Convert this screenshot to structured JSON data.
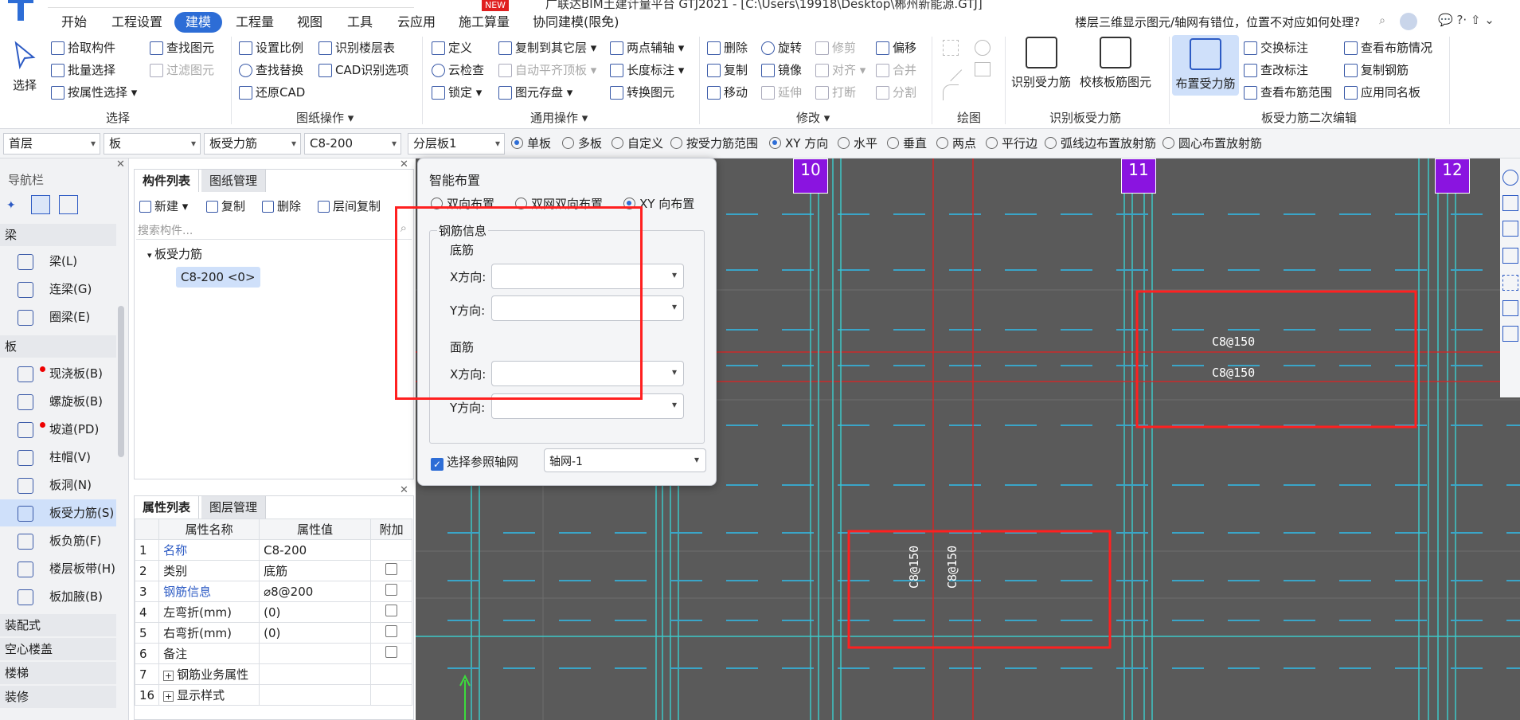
{
  "title": {
    "text": "广联达BIM土建计量平台 GTJ2021 - [C:\\Users\\19918\\Desktop\\郴州新能源.GTJ]",
    "new_badge": "NEW",
    "help_search": "楼层三维显示图元/轴网有错位，位置不对应如何处理?"
  },
  "menu": [
    "开始",
    "工程设置",
    "建模",
    "工程量",
    "视图",
    "工具",
    "云应用",
    "施工算量",
    "协同建模(限免)"
  ],
  "ribbon": {
    "select_btn": "选择",
    "select": [
      "拾取构件",
      "批量选择",
      "按属性选择",
      "查找图元",
      "过滤图元"
    ],
    "select_group": "选择",
    "drawing": [
      "设置比例",
      "识别楼层表",
      "查找替换",
      "CAD识别选项",
      "还原CAD"
    ],
    "drawing_group": "图纸操作",
    "common": [
      "定义",
      "复制到其它层",
      "两点辅轴",
      "云检查",
      "自动平齐顶板",
      "长度标注",
      "锁定",
      "图元存盘",
      "转换图元"
    ],
    "common_group": "通用操作",
    "modify": [
      "删除",
      "旋转",
      "修剪",
      "偏移",
      "复制",
      "镜像",
      "对齐",
      "合并",
      "移动",
      "延伸",
      "打断",
      "分割"
    ],
    "modify_group": "修改",
    "draw_group": "绘图",
    "recog": [
      "识别受力筋",
      "校核板筋图元"
    ],
    "recog_group": "识别板受力筋",
    "place_btn": "布置受力筋",
    "edit": [
      "交换标注",
      "查看布筋情况",
      "查改标注",
      "复制钢筋",
      "查看布筋范围",
      "应用同名板"
    ],
    "edit_group": "板受力筋二次编辑"
  },
  "optbar": {
    "floor": "首层",
    "type": "板",
    "sub": "板受力筋",
    "spec": "C8-200",
    "layer": "分层板1",
    "radios": [
      "单板",
      "多板",
      "自定义",
      "按受力筋范围",
      "XY 方向",
      "水平",
      "垂直",
      "两点",
      "平行边",
      "弧线边布置放射筋",
      "圆心布置放射筋"
    ]
  },
  "nav": {
    "title": "导航栏",
    "sections": [
      "梁",
      "板",
      "装配式",
      "空心楼盖",
      "楼梯",
      "装修"
    ],
    "beam_items": [
      "梁(L)",
      "连梁(G)",
      "圈梁(E)"
    ],
    "slab_items": [
      "现浇板(B)",
      "螺旋板(B)",
      "坡道(PD)",
      "柱帽(V)",
      "板洞(N)",
      "板受力筋(S)",
      "板负筋(F)",
      "楼层板带(H)",
      "板加腋(B)"
    ]
  },
  "complist": {
    "tabs": [
      "构件列表",
      "图纸管理"
    ],
    "toolbar": [
      "新建",
      "复制",
      "删除",
      "层间复制"
    ],
    "search_placeholder": "搜索构件...",
    "tree_root": "板受力筋",
    "tree_item": "C8-200 <0>"
  },
  "props": {
    "tabs": [
      "属性列表",
      "图层管理"
    ],
    "headers": [
      "属性名称",
      "属性值",
      "附加"
    ],
    "rows": [
      {
        "no": "1",
        "name": "名称",
        "value": "C8-200"
      },
      {
        "no": "2",
        "name": "类别",
        "value": "底筋"
      },
      {
        "no": "3",
        "name": "钢筋信息",
        "value": "⌀8@200"
      },
      {
        "no": "4",
        "name": "左弯折(mm)",
        "value": "(0)"
      },
      {
        "no": "5",
        "name": "右弯折(mm)",
        "value": "(0)"
      },
      {
        "no": "6",
        "name": "备注",
        "value": ""
      },
      {
        "no": "7",
        "name": "钢筋业务属性",
        "value": ""
      },
      {
        "no": "16",
        "name": "显示样式",
        "value": ""
      }
    ]
  },
  "dialog": {
    "title": "智能布置",
    "modes": [
      "双向布置",
      "双网双向布置",
      "XY 向布置"
    ],
    "group": "钢筋信息",
    "bottom": "底筋",
    "top": "面筋",
    "x_label": "X方向:",
    "y_label": "Y方向:",
    "checkbox": "选择参照轴网",
    "axis": "轴网-1"
  },
  "canvas": {
    "axes": [
      "10",
      "11",
      "12"
    ],
    "rebar_labels": [
      "C8@150",
      "C8@150",
      "C8@150",
      "C8@150"
    ]
  }
}
